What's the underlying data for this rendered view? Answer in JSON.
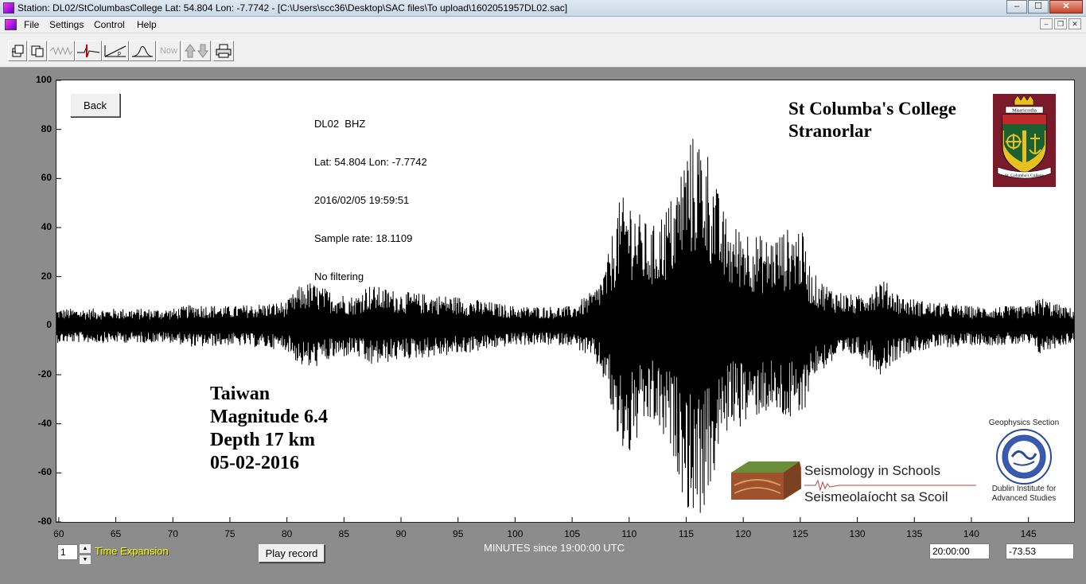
{
  "window": {
    "title": "Station: DL02/StColumbasCollege Lat: 54.804 Lon: -7.7742 - [C:\\Users\\scc36\\Desktop\\SAC files\\To upload\\1602051957DL02.sac]",
    "minimize": "–",
    "maximize": "☐",
    "close": "✕"
  },
  "menu": {
    "items": [
      "File",
      "Settings",
      "Control",
      "Help"
    ],
    "mdi_buttons": [
      "–",
      "❐",
      "✕"
    ]
  },
  "toolbar": {
    "now_label": "Now"
  },
  "plot": {
    "back_label": "Back",
    "info_lines": [
      "DL02  BHZ",
      "Lat: 54.804 Lon: -7.7742",
      "2016/02/05 19:59:51",
      "Sample rate: 18.1109",
      "No filtering"
    ],
    "school_lines": [
      "St Columba's College",
      "Stranorlar"
    ],
    "crest_text": "Misericordia",
    "crest_banner": "St. Columba's College",
    "event_lines": [
      "Taiwan",
      "Magnitude 6.4",
      "Depth 17 km",
      "05-02-2016"
    ],
    "sis_line1": "Seismology in Schools",
    "sis_line2": "Seismeolaíocht sa Scoil",
    "dias_header": "Geophysics Section",
    "dias_footer": [
      "Dublin Institute for",
      "Advanced Studies"
    ]
  },
  "chart_data": {
    "type": "line",
    "xlabel": "MINUTES since 19:00:00 UTC",
    "ylabel": "",
    "xlim": [
      59.8,
      149
    ],
    "ylim": [
      -80,
      100
    ],
    "y_ticks": [
      100,
      80,
      60,
      40,
      20,
      0,
      -20,
      -40,
      -60,
      -80
    ],
    "x_ticks": [
      60,
      65,
      70,
      75,
      80,
      85,
      90,
      95,
      100,
      105,
      110,
      115,
      120,
      125,
      130,
      135,
      140,
      145
    ],
    "x_tick_labels": [
      "60",
      "65",
      "70",
      "75",
      "80",
      "85",
      "90",
      "95",
      "100",
      "105",
      "110",
      "115",
      "120",
      "125",
      "130",
      "135",
      "140",
      "145"
    ],
    "envelope": {
      "x": [
        59.8,
        65,
        70,
        72,
        75,
        80,
        81,
        82,
        84,
        86,
        87,
        90,
        95,
        100,
        105,
        107,
        108,
        109,
        110,
        111,
        112,
        113,
        114,
        115,
        116,
        117,
        118,
        119,
        120,
        121,
        122,
        123,
        124,
        125,
        126,
        127,
        128,
        130,
        132,
        134,
        136,
        140,
        145,
        146,
        148,
        149
      ],
      "amp": [
        7,
        7,
        7,
        9,
        8,
        10,
        16,
        18,
        14,
        12,
        17,
        14,
        12,
        8,
        8,
        15,
        25,
        50,
        55,
        45,
        40,
        48,
        55,
        75,
        80,
        72,
        50,
        40,
        42,
        38,
        36,
        38,
        40,
        42,
        22,
        18,
        15,
        12,
        20,
        12,
        10,
        8,
        8,
        12,
        8,
        7
      ]
    },
    "grid": false,
    "legend": "none"
  },
  "bottom": {
    "expansion_value": "1",
    "spin_up": "▲",
    "spin_down": "▼",
    "time_expansion_label": "Time Expansion",
    "play_label": "Play record",
    "time_readout": "20:00:00",
    "value_readout": "-73.53"
  },
  "colors": {
    "plot_bg": "#ffffff",
    "frame_bg": "#8c8c8c",
    "trace": "#000000",
    "label_yellow": "#ffff00",
    "crest_red": "#7a1a2a"
  }
}
